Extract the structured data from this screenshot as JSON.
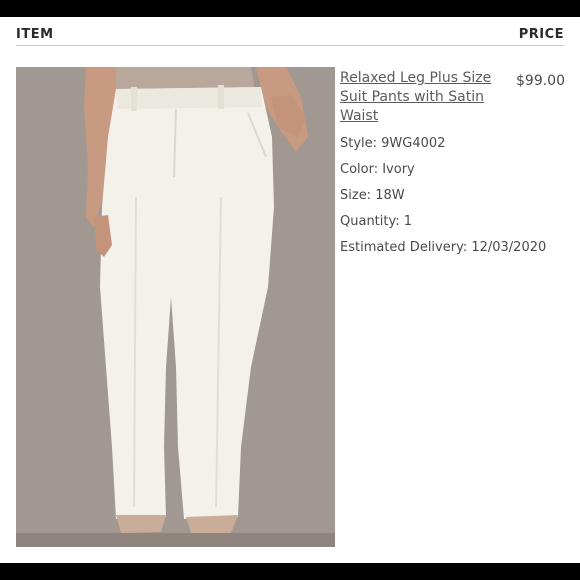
{
  "header": {
    "item_label": "ITEM",
    "price_label": "PRICE"
  },
  "product": {
    "title": "Relaxed Leg Plus Size Suit Pants with Satin Waist",
    "price": "$99.00",
    "style": "Style: 9WG4002",
    "color": "Color: Ivory",
    "size": "Size: 18W",
    "quantity": "Quantity: 1",
    "delivery": "Estimated Delivery: 12/03/2020",
    "image_alt": "product-photo-ivory-pants"
  },
  "colors": {
    "photo_background": "#a59b94",
    "pants": "#f3f1ea",
    "skin": "#c99a82",
    "header_rule": "#cfcfcf"
  }
}
